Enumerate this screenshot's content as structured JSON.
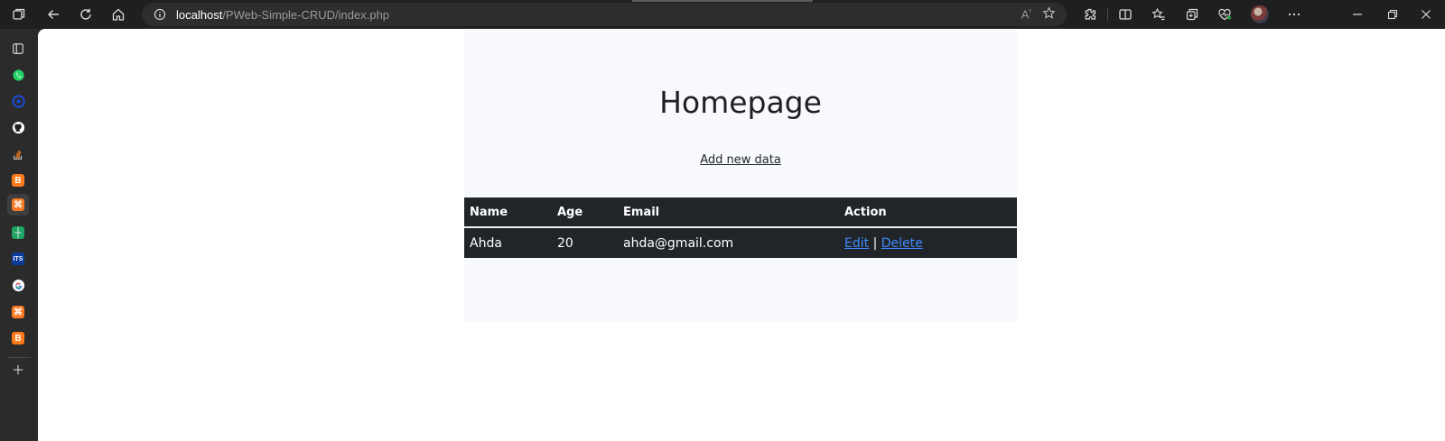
{
  "browser": {
    "url_host": "localhost",
    "url_path": "/PWeb-Simple-CRUD/index.php"
  },
  "sidebar": {
    "items": [
      {
        "name": "collections",
        "color": "#dcdcdc"
      },
      {
        "name": "whatsapp",
        "color": "#25d366"
      },
      {
        "name": "app-blue",
        "color": "#1e4bd6"
      },
      {
        "name": "github",
        "color": "#ffffff"
      },
      {
        "name": "stackoverflow",
        "color": "#f48024"
      },
      {
        "name": "blogger",
        "color": "#ff7a1a"
      },
      {
        "name": "xampp",
        "color": "#fb7a24"
      },
      {
        "name": "sheets",
        "color": "#21a464"
      },
      {
        "name": "its",
        "color": "#0b3b9c",
        "label": "ITS"
      },
      {
        "name": "google",
        "color": "#ffffff"
      },
      {
        "name": "xampp-2",
        "color": "#fb7a24"
      },
      {
        "name": "blogger-2",
        "color": "#ff7a1a"
      }
    ]
  },
  "page": {
    "title": "Homepage",
    "add_link": "Add new data"
  },
  "table": {
    "headers": [
      "Name",
      "Age",
      "Email",
      "Action"
    ],
    "rows": [
      {
        "name": "Ahda",
        "age": "20",
        "email": "ahda@gmail.com",
        "edit": "Edit",
        "separator": "|",
        "delete": "Delete"
      }
    ]
  },
  "colors": {
    "table_bg": "#212529",
    "link": "#3d8bfd",
    "container_bg": "#f8f9fc"
  }
}
